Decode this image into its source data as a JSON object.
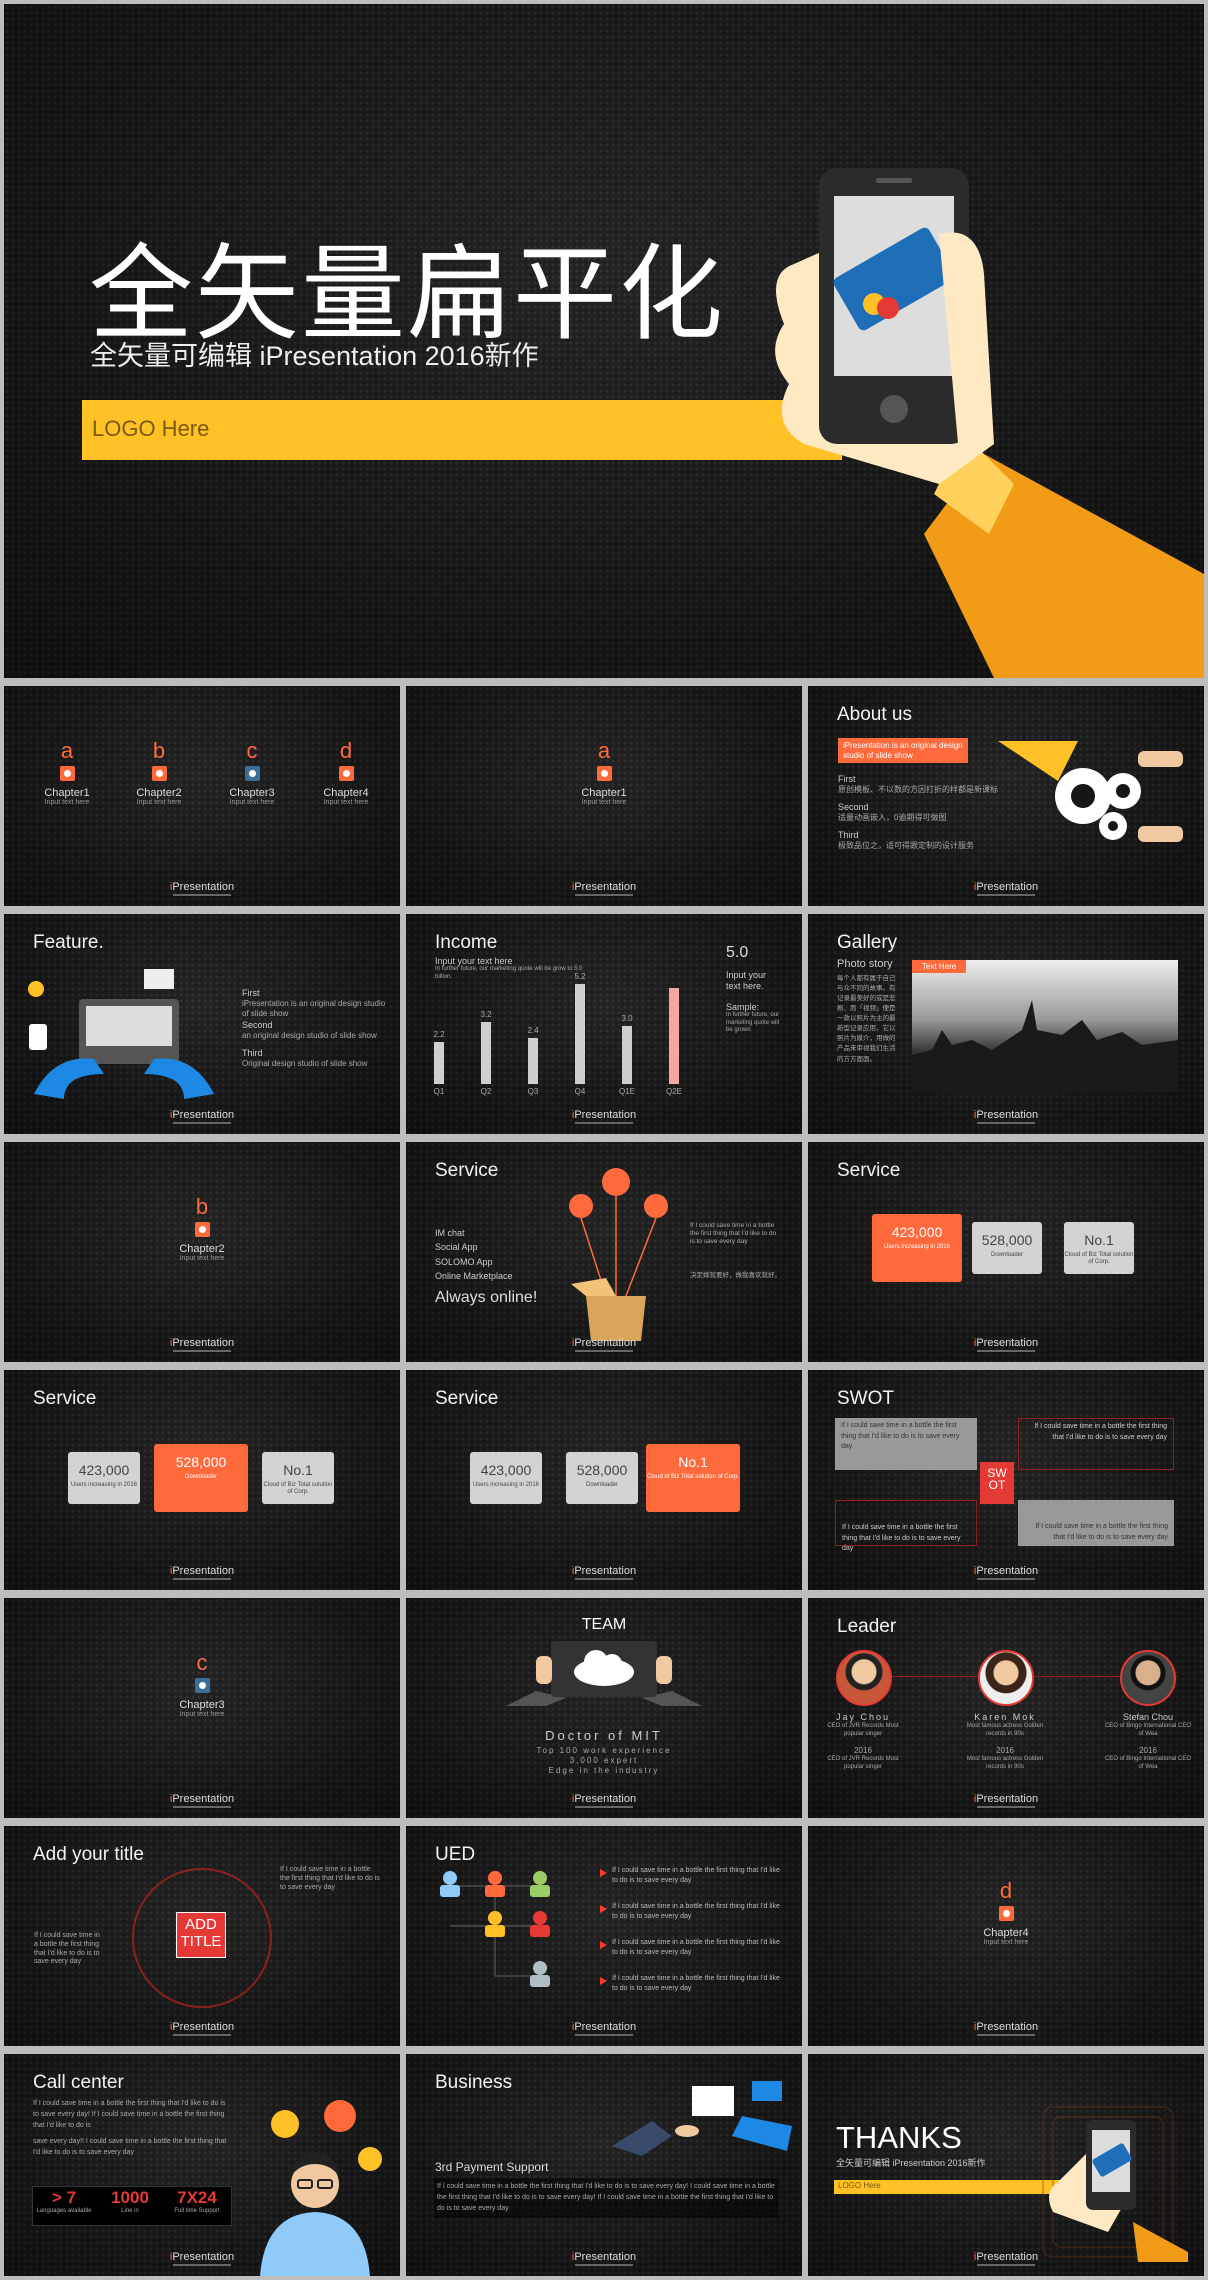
{
  "brand": "iPresentation",
  "cover": {
    "title": "全矢量扁平化",
    "subtitle": "全矢量可编辑 iPresentation 2016新作",
    "logo": "LOGO Here"
  },
  "chapters": {
    "a": {
      "letter": "a",
      "title": "Chapter1",
      "sub": "Input text here"
    },
    "b": {
      "letter": "b",
      "title": "Chapter2",
      "sub": "Input text here"
    },
    "c": {
      "letter": "c",
      "title": "Chapter3",
      "sub": "Input text here"
    },
    "d": {
      "letter": "d",
      "title": "Chapter4",
      "sub": "Input text here"
    }
  },
  "about": {
    "title": "About us",
    "banner": "iPresentation is an original design studio of slide show",
    "items": [
      {
        "h": "First",
        "t": "原创模板、不以数的方因打折的样都是新课标"
      },
      {
        "h": "Second",
        "t": "适量动画嵌入，0逾期得可做图"
      },
      {
        "h": "Third",
        "t": "极致品位之，适可得跟定制的设计服务"
      }
    ]
  },
  "feature": {
    "title": "Feature.",
    "items": [
      {
        "h": "First",
        "t": "iPresentation is an original design studio of slide show"
      },
      {
        "h": "Second",
        "t": "an original design studio of slide show"
      },
      {
        "h": "Third",
        "t": "Original design studio of slide show"
      }
    ]
  },
  "income": {
    "title": "Income",
    "note": "Input your text here",
    "note2": "In further future, our marketing quote will be grow to 5.0 billion.",
    "big": "5.0",
    "side": "Input your text here.",
    "sample": "Sample:",
    "sample_t": "In further future, our marketing quote will be grown"
  },
  "chart_data": {
    "type": "bar",
    "categories": [
      "Q1",
      "Q2",
      "Q3",
      "Q4",
      "Q1E",
      "Q2E"
    ],
    "values": [
      2.2,
      3.2,
      2.4,
      5.2,
      3.0,
      5.0
    ]
  },
  "gallery": {
    "title": "Gallery",
    "sub": "Photo story",
    "tag": "Text Here",
    "body": "每个人都有属于自己与众不同的故事，有记录最美好的或是悲剧、而「视频」便是一款以照片为主的最新型记录应用，它以照片为媒介，用做的产品来审视我们生活的方方面面。"
  },
  "service1": {
    "title": "Service",
    "items": [
      "IM chat",
      "Social App",
      "SOLOMO App",
      "Online Marketplace"
    ],
    "tagline": "Always online!",
    "t1": "If I could save time in a bottle the first thing that I'd like to do is to save every day",
    "t2": "决定嫁就要好，做我喜欢就好。"
  },
  "svc_boxes": [
    {
      "v": "423,000",
      "d": "Users increasing in 2016"
    },
    {
      "v": "528,000",
      "d": "Downloader"
    },
    {
      "v": "No.1",
      "d": "Cloud of Biz Total solution of Corp."
    }
  ],
  "service_title": "Service",
  "swot": {
    "title": "SWOT",
    "text": "If I could save time in a bottle the first thing that I'd like to do is to save every day",
    "s": "S",
    "w": "W",
    "o": "O",
    "t": "T"
  },
  "team": {
    "title": "TEAM",
    "l1": "Doctor of MIT",
    "l2": "Top 100 work experience",
    "l3": "3,000 expert",
    "l4": "Edge in the industry"
  },
  "leader": {
    "title": "Leader",
    "people": [
      {
        "n": "Jay Chou",
        "r": "CEO of JVR Records Most popular singer",
        "y": "2016",
        "y2": "CEO of JVR Records Most popular singer"
      },
      {
        "n": "Karen Mok",
        "r": "Most famous actress Golden records in 90s",
        "y": "2016",
        "y2": "Most famous actress Golden records in 90s"
      },
      {
        "n": "Stefan Chou",
        "r": "CEO of Bingo International CEO of Wea",
        "y": "2016",
        "y2": "CEO of Bingo International CEO of Wea"
      }
    ]
  },
  "addtitle": {
    "title": "Add your title",
    "center": "ADD TITLE",
    "t1": "If I could save time in a bottle the first thing that I'd like to do is to save every day",
    "t2": "If I could save time in a bottle the first thing that I'd like to do is to save every day"
  },
  "ued": {
    "title": "UED",
    "rows": [
      "If I could save time in a bottle the first thing that I'd like to do is to save every day",
      "If I could save time in a bottle the first thing that I'd like to do is to save every day",
      "If I could save time in a bottle the first thing that I'd like to do is to save every day",
      "If I could save time in a bottle the first thing that I'd like to do is to save every day"
    ]
  },
  "call": {
    "title": "Call center",
    "t": "If I could save time in a bottle the first thing that I'd like to do is to save every day! If I could save time in a bottle the first thing that I'd like to do is",
    "t2": "save every day!! I could save time in a bottle the first thing that I'd like to do is to save every day",
    "stats": [
      {
        "v": "> 7",
        "l": "Languages available"
      },
      {
        "v": "1000",
        "l": "Line in"
      },
      {
        "v": "7X24",
        "l": "Full time Support"
      }
    ]
  },
  "business": {
    "title": "Business",
    "sub": "3rd Payment Support",
    "t": "If I could save time in a bottle the first thing that I'd like to do is to save every day! I could save time in a bottle the first thing that I'd like to do is to save every day! If I could save time in a bottle the first thing that I'd like to do is to save every day"
  },
  "thanks": {
    "title": "THANKS",
    "sub": "全矢量可编辑 iPresentation 2016新作",
    "logo": "LOGO Here"
  }
}
